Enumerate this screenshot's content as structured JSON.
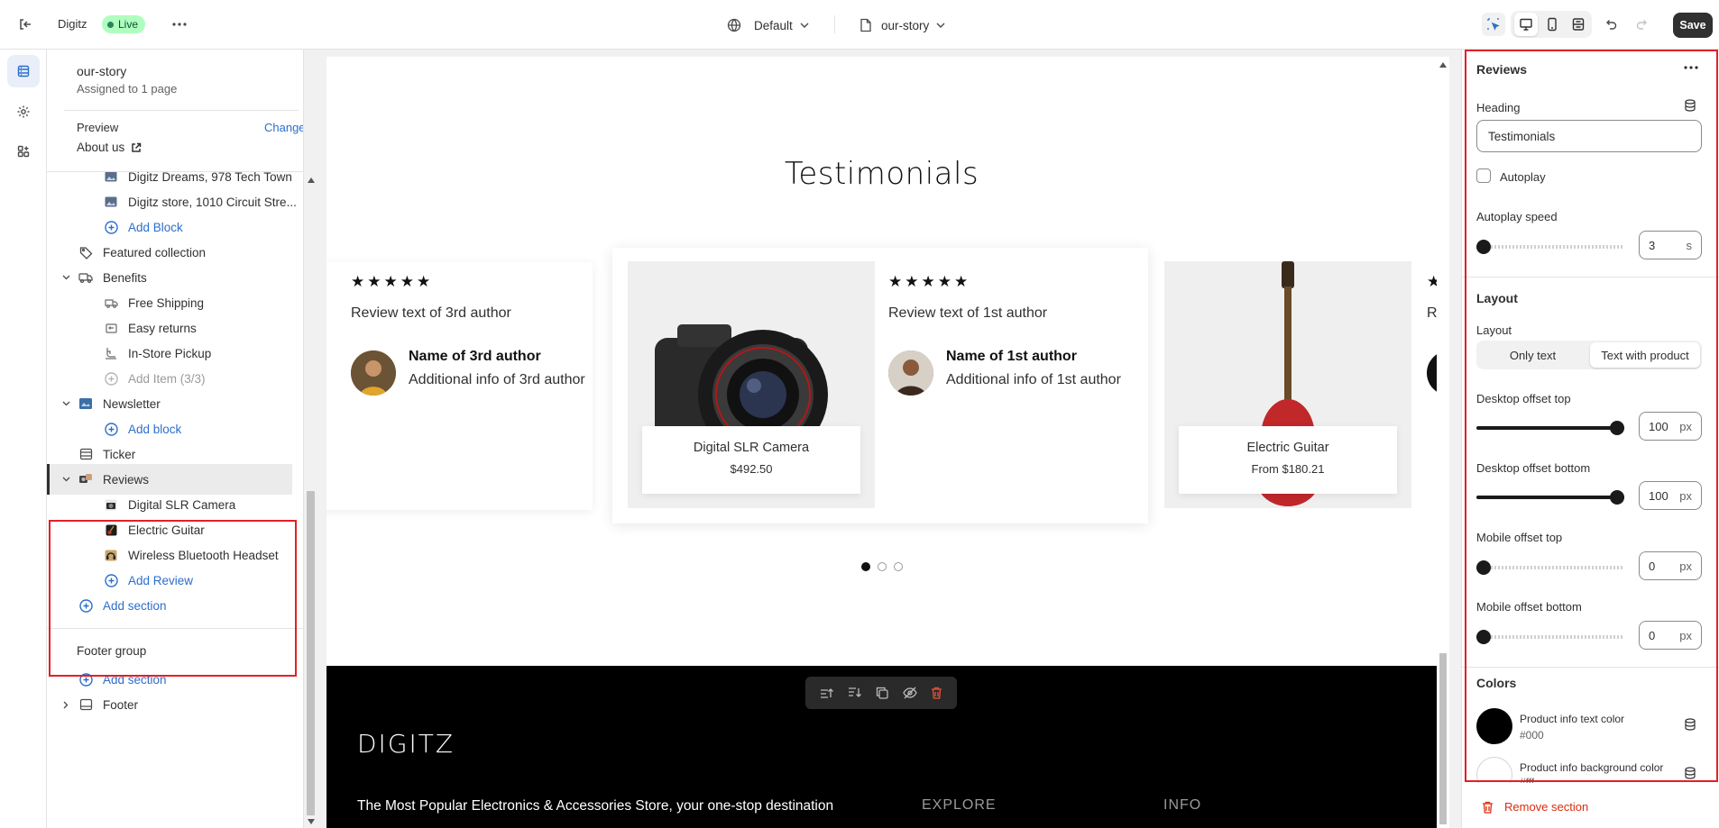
{
  "topbar": {
    "store_name": "Digitz",
    "live_badge": "Live",
    "theme_select": "Default",
    "template_select": "our-story",
    "save_label": "Save"
  },
  "sidebar": {
    "template_name": "our-story",
    "assigned": "Assigned to 1 page",
    "preview_label": "Preview",
    "change_link": "Change",
    "preview_page": "About us",
    "items": [
      {
        "label": "Digitz Dreams, 978 Tech Town",
        "icon": "image-icon"
      },
      {
        "label": "Digitz store, 1010 Circuit Stre...",
        "icon": "image-icon"
      },
      {
        "label": "Add Block",
        "icon": "plus-circle-icon"
      },
      {
        "label": "Featured collection",
        "icon": "tag-icon"
      },
      {
        "label": "Benefits",
        "icon": "benefits-icon"
      },
      {
        "label": "Free Shipping",
        "icon": "truck-icon"
      },
      {
        "label": "Easy returns",
        "icon": "returns-icon"
      },
      {
        "label": "In-Store Pickup",
        "icon": "pickup-icon"
      },
      {
        "label": "Add Item (3/3)",
        "icon": "plus-circle-icon"
      },
      {
        "label": "Newsletter",
        "icon": "newsletter-icon"
      },
      {
        "label": "Add block",
        "icon": "plus-circle-icon"
      },
      {
        "label": "Ticker",
        "icon": "ticker-icon"
      },
      {
        "label": "Reviews",
        "icon": "reviews-icon"
      },
      {
        "label": "Digital SLR Camera",
        "icon": "camera-thumb-icon"
      },
      {
        "label": "Electric Guitar",
        "icon": "guitar-thumb-icon"
      },
      {
        "label": "Wireless Bluetooth Headset",
        "icon": "headset-thumb-icon"
      },
      {
        "label": "Add Review",
        "icon": "plus-circle-icon"
      },
      {
        "label": "Add section",
        "icon": "plus-circle-icon"
      }
    ],
    "footer_group": "Footer group",
    "footer_add_section": "Add section",
    "footer_item": "Footer"
  },
  "preview": {
    "heading": "Testimonials",
    "stars": "★★★★★",
    "reviews": [
      {
        "text": "Review text of 3rd author",
        "name": "Name of 3rd author",
        "info": "Additional info of 3rd author"
      },
      {
        "product": "Digital SLR Camera",
        "price": "$492.50"
      },
      {
        "text": "Review text of 1st author",
        "name": "Name of 1st author",
        "info": "Additional info of 1st author"
      },
      {
        "product": "Electric Guitar",
        "price": "From $180.21"
      },
      {
        "text": "Re"
      }
    ],
    "footer": {
      "logo": "DIGITZ",
      "tagline": "The Most Popular Electronics & Accessories Store, your one-stop destination",
      "explore": "EXPLORE",
      "info": "INFO"
    }
  },
  "panel": {
    "title": "Reviews",
    "heading_label": "Heading",
    "heading_value": "Testimonials",
    "autoplay_label": "Autoplay",
    "autoplay_checked": false,
    "autoplay_speed_label": "Autoplay speed",
    "autoplay_speed_value": "3",
    "autoplay_speed_unit": "s",
    "autoplay_speed_level": 0,
    "layout_section": "Layout",
    "layout_label": "Layout",
    "layout_options": [
      "Only text",
      "Text with product"
    ],
    "layout_selected": "Text with product",
    "desktop_top_label": "Desktop offset top",
    "desktop_top_value": "100",
    "desktop_top_level": 1,
    "desktop_bottom_label": "Desktop offset bottom",
    "desktop_bottom_value": "100",
    "desktop_bottom_level": 1,
    "mobile_top_label": "Mobile offset top",
    "mobile_top_value": "0",
    "mobile_top_level": 0,
    "mobile_bottom_label": "Mobile offset bottom",
    "mobile_bottom_value": "0",
    "mobile_bottom_level": 0,
    "unit_px": "px",
    "colors_section": "Colors",
    "color1_label": "Product info text color",
    "color1_value": "#000",
    "color2_label": "Product info background color",
    "color2_value": "#fff",
    "remove_label": "Remove section"
  },
  "colors": {
    "accent": "#2c6ecb",
    "live_green": "#29845a",
    "highlight_red": "#e22026",
    "danger": "#d82c0d"
  }
}
